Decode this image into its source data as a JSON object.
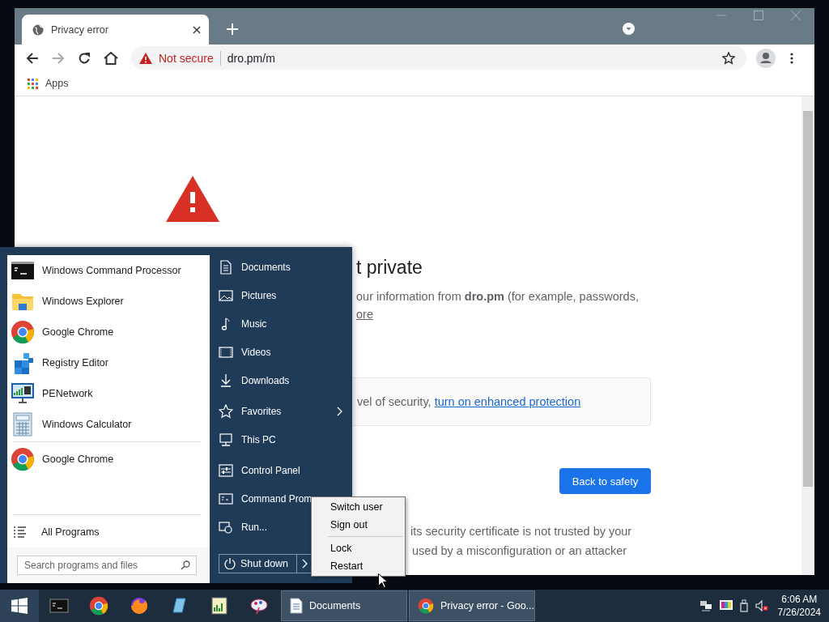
{
  "browser": {
    "tabs": [
      {
        "title": "Privacy error",
        "selected": true
      }
    ],
    "address": {
      "security_label": "Not secure",
      "url": "dro.pm/m"
    },
    "bookmarks": [
      {
        "label": "Apps"
      }
    ],
    "page": {
      "heading": "t private",
      "paragraph": "our information from **dro.pm** (for example, passwords,",
      "learn_more_link": "ore",
      "enhanced_box": {
        "text": "vel of security, ",
        "link": "turn on enhanced protection"
      },
      "primary_button": "Back to safety",
      "details_lines": [
        "its security certificate is not trusted by your",
        "used by a misconfiguration or an attacker"
      ]
    }
  },
  "start_menu": {
    "programs": [
      {
        "label": "Windows Command Processor"
      },
      {
        "label": "Windows Explorer"
      },
      {
        "label": "Google Chrome"
      },
      {
        "label": "Registry Editor"
      },
      {
        "label": "PENetwork"
      },
      {
        "label": "Windows Calculator"
      }
    ],
    "pinned": [
      {
        "label": "Google Chrome"
      }
    ],
    "all_programs": "All Programs",
    "search": {
      "placeholder": "Search programs and files"
    },
    "places": [
      {
        "label": "Documents"
      },
      {
        "label": "Pictures"
      },
      {
        "label": "Music"
      },
      {
        "label": "Videos"
      },
      {
        "label": "Downloads"
      },
      {
        "label": "Favorites",
        "has_submenu": true
      },
      {
        "label": "This PC"
      },
      {
        "label": "Control Panel"
      },
      {
        "label": "Command Prom"
      },
      {
        "label": "Run..."
      }
    ],
    "shutdown_button": "Shut down",
    "power_menu": [
      [
        "Switch user",
        "Sign out"
      ],
      [
        "Lock",
        "Restart"
      ]
    ]
  },
  "taskbar": {
    "tasks": [
      {
        "label": "Documents"
      },
      {
        "label": "Privacy error - Goo..."
      }
    ],
    "clock": {
      "time": "6:06 AM",
      "date": "7/26/2024"
    }
  }
}
